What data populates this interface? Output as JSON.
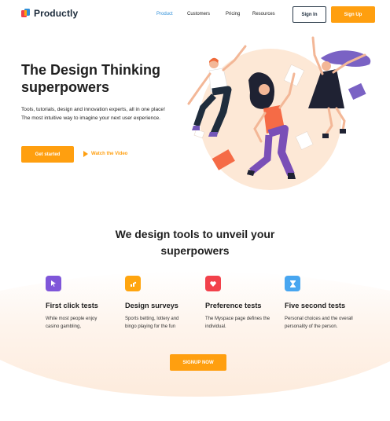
{
  "brand": {
    "name": "Productly"
  },
  "nav": {
    "items": [
      {
        "label": "Product",
        "active": true
      },
      {
        "label": "Customers",
        "active": false
      },
      {
        "label": "Pricing",
        "active": false
      },
      {
        "label": "Resources",
        "active": false
      }
    ],
    "signin_label": "Sign In",
    "signup_label": "Sign Up"
  },
  "hero": {
    "title": "The Design Thinking superpowers",
    "description": "Tools, tutorials, design and innovation experts, all in one place! The most intuitive way to imagine your next user experience.",
    "cta_label": "Get started",
    "video_label": "Watch the Video"
  },
  "section": {
    "title": "We design tools to unveil your superpowers",
    "features": [
      {
        "title": "First click tests",
        "desc": "While most people enjoy casino gambling,",
        "icon": "cursor-icon",
        "color": "#7f56d9"
      },
      {
        "title": "Design surveys",
        "desc": "Sports betting, lottery and bingo playing for the fun",
        "icon": "chart-icon",
        "color": "#ffa50f"
      },
      {
        "title": "Preference tests",
        "desc": "The Myspace page defines the individual.",
        "icon": "heart-icon",
        "color": "#f2414b"
      },
      {
        "title": "Five second tests",
        "desc": "Personal choices and the overall personality of the person.",
        "icon": "hourglass-icon",
        "color": "#48a6f0"
      }
    ],
    "cta_label": "SIGNUP NOW"
  },
  "colors": {
    "accent": "#ff9f0f",
    "link_active": "#2f8fd8",
    "dark": "#1b2a3a"
  }
}
